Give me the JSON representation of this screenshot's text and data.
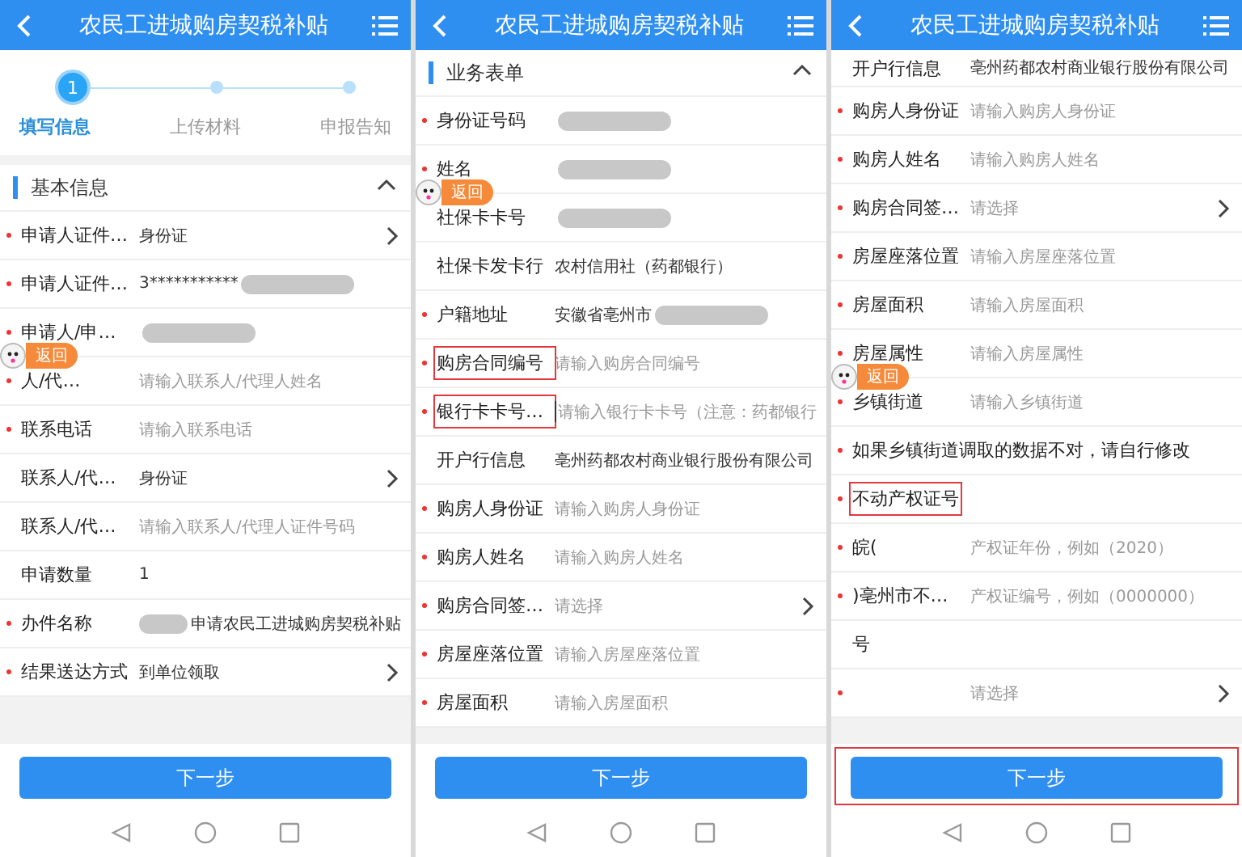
{
  "screens": [
    {
      "title": "农民工进城购房契税补贴",
      "steps": [
        {
          "number": "1",
          "label": "填写信息",
          "selected": true
        },
        {
          "label": "上传材料",
          "selected": false
        },
        {
          "label": "申报告知",
          "selected": false
        }
      ],
      "section": {
        "title": "基本信息",
        "expanded": true
      },
      "rows": [
        {
          "kind": "select",
          "label": "申请人证件…",
          "required": true,
          "value": "身份证"
        },
        {
          "kind": "value",
          "label": "申请人证件…",
          "required": true,
          "value": "3***********",
          "redacted": true
        },
        {
          "kind": "value",
          "label": "申请人/申…",
          "required": true,
          "redacted": true,
          "return_badge": "返回"
        },
        {
          "kind": "input",
          "label": "人/代…",
          "required": true,
          "placeholder": "请输入联系人/代理人姓名"
        },
        {
          "kind": "input",
          "label": "联系电话",
          "required": true,
          "placeholder": "请输入联系电话"
        },
        {
          "kind": "select",
          "label": "联系人/代…",
          "required": false,
          "value": "身份证"
        },
        {
          "kind": "input",
          "label": "联系人/代…",
          "required": false,
          "placeholder": "请输入联系人/代理人证件号码"
        },
        {
          "kind": "value",
          "label": "申请数量",
          "required": false,
          "value": "1"
        },
        {
          "kind": "value",
          "label": "办件名称",
          "required": true,
          "redacted_before": true,
          "value": "申请农民工进城购房契税补贴"
        },
        {
          "kind": "select",
          "label": "结果送达方式",
          "required": true,
          "value": "到单位领取"
        }
      ],
      "next_button": {
        "label": "下一步"
      }
    },
    {
      "title": "农民工进城购房契税补贴",
      "section": {
        "title": "业务表单",
        "expanded": true
      },
      "rows": [
        {
          "kind": "value",
          "label": "身份证号码",
          "required": true,
          "redacted": true
        },
        {
          "kind": "value",
          "label": "姓名",
          "required": true,
          "redacted": true,
          "return_badge": "返回"
        },
        {
          "kind": "value",
          "label": "社保卡卡号",
          "required": false,
          "redacted": true
        },
        {
          "kind": "value",
          "label": "社保卡发卡行",
          "required": false,
          "value": "农村信用社（药都银行）"
        },
        {
          "kind": "value",
          "label": "户籍地址",
          "required": true,
          "value": "安徽省亳州市",
          "redacted": true
        },
        {
          "kind": "input",
          "label": "购房合同编号",
          "required": true,
          "highlight": true,
          "placeholder": "请输入购房合同编号"
        },
        {
          "kind": "input",
          "label": "银行卡卡号…",
          "required": true,
          "highlight": true,
          "focused": true,
          "placeholder": "请输入银行卡卡号（注意：药都银行"
        },
        {
          "kind": "value",
          "label": "开户行信息",
          "required": false,
          "value": "亳州药都农村商业银行股份有限公司"
        },
        {
          "kind": "input",
          "label": "购房人身份证",
          "required": true,
          "placeholder": "请输入购房人身份证"
        },
        {
          "kind": "input",
          "label": "购房人姓名",
          "required": true,
          "placeholder": "请输入购房人姓名"
        },
        {
          "kind": "select",
          "label": "购房合同签…",
          "required": true,
          "placeholder": "请选择"
        },
        {
          "kind": "input",
          "label": "房屋座落位置",
          "required": true,
          "placeholder": "请输入房屋座落位置"
        },
        {
          "kind": "input",
          "label": "房屋面积",
          "required": true,
          "placeholder": "请输入房屋面积"
        }
      ],
      "next_button": {
        "label": "下一步"
      }
    },
    {
      "title": "农民工进城购房契税补贴",
      "rows": [
        {
          "kind": "value",
          "label": "开户行信息",
          "required": false,
          "value": "亳州药都农村商业银行股份有限公司"
        },
        {
          "kind": "input",
          "label": "购房人身份证",
          "required": true,
          "placeholder": "请输入购房人身份证"
        },
        {
          "kind": "input",
          "label": "购房人姓名",
          "required": true,
          "placeholder": "请输入购房人姓名"
        },
        {
          "kind": "select",
          "label": "购房合同签…",
          "required": true,
          "placeholder": "请选择"
        },
        {
          "kind": "input",
          "label": "房屋座落位置",
          "required": true,
          "placeholder": "请输入房屋座落位置"
        },
        {
          "kind": "input",
          "label": "房屋面积",
          "required": true,
          "placeholder": "请输入房屋面积"
        },
        {
          "kind": "input",
          "label": "房屋属性",
          "required": true,
          "placeholder": "请输入房屋属性",
          "return_badge": "返回"
        },
        {
          "kind": "input",
          "label": "乡镇街道",
          "required": true,
          "placeholder": "请输入乡镇街道"
        },
        {
          "kind": "note",
          "label": "如果乡镇街道调取的数据不对，请自行修改",
          "required": true
        },
        {
          "kind": "note",
          "label": "不动产权证号",
          "required": true,
          "highlight": true
        },
        {
          "kind": "input",
          "label": "皖(",
          "required": true,
          "placeholder": "产权证年份，例如（2020）"
        },
        {
          "kind": "input",
          "label": ")亳州市不…",
          "required": true,
          "placeholder": "产权证编号，例如（0000000）"
        },
        {
          "kind": "note",
          "label": "号",
          "required": false
        },
        {
          "kind": "select",
          "label": "",
          "required": true,
          "placeholder": "请选择"
        }
      ],
      "next_button": {
        "label": "下一步",
        "highlight": true
      }
    }
  ]
}
